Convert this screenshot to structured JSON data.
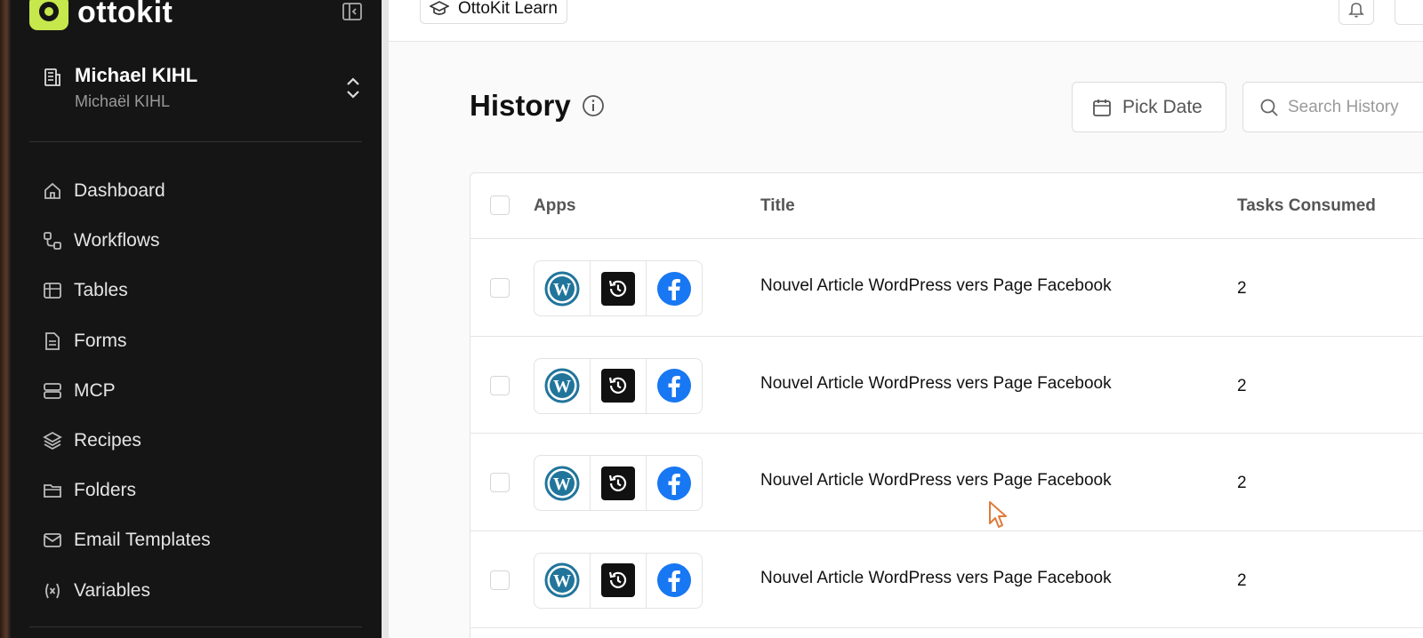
{
  "brand": {
    "name": "ottokit",
    "accent": "#c6e84c"
  },
  "account": {
    "name": "Michael KIHL",
    "sub": "Michaël KIHL"
  },
  "nav": [
    {
      "label": "Dashboard",
      "icon": "home-icon"
    },
    {
      "label": "Workflows",
      "icon": "workflow-icon"
    },
    {
      "label": "Tables",
      "icon": "table-icon"
    },
    {
      "label": "Forms",
      "icon": "form-icon"
    },
    {
      "label": "MCP",
      "icon": "server-icon"
    },
    {
      "label": "Recipes",
      "icon": "layers-icon"
    },
    {
      "label": "Folders",
      "icon": "folder-icon"
    },
    {
      "label": "Email Templates",
      "icon": "mail-icon"
    },
    {
      "label": "Variables",
      "icon": "variable-icon"
    }
  ],
  "topbar": {
    "learn_label": "OttoKit Learn"
  },
  "page": {
    "title": "History"
  },
  "filters": {
    "pick_date_label": "Pick Date",
    "search_placeholder": "Search History"
  },
  "table": {
    "columns": [
      "Apps",
      "Title",
      "Tasks Consumed"
    ],
    "rows": [
      {
        "apps": [
          "wordpress-icon",
          "history-icon",
          "facebook-icon"
        ],
        "title": "Nouvel Article WordPress vers Page Facebook",
        "tasks": "2"
      },
      {
        "apps": [
          "wordpress-icon",
          "history-icon",
          "facebook-icon"
        ],
        "title": "Nouvel Article WordPress vers Page Facebook",
        "tasks": "2"
      },
      {
        "apps": [
          "wordpress-icon",
          "history-icon",
          "facebook-icon"
        ],
        "title": "Nouvel Article WordPress vers Page Facebook",
        "tasks": "2"
      },
      {
        "apps": [
          "wordpress-icon",
          "history-icon",
          "facebook-icon"
        ],
        "title": "Nouvel Article WordPress vers Page Facebook",
        "tasks": "2"
      }
    ]
  },
  "colors": {
    "sidebar_bg": "#151515",
    "facebook": "#1877f2",
    "wordpress": "#21759b"
  }
}
